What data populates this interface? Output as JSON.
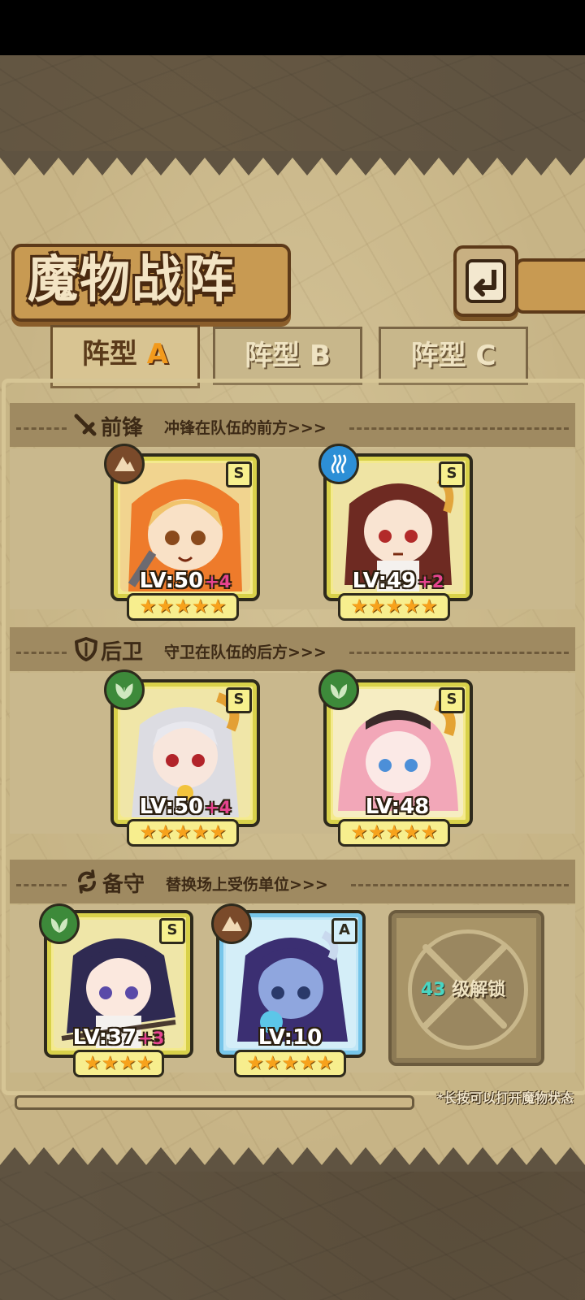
{
  "header": {
    "title": "魔物战阵"
  },
  "back_button": {
    "icon": "return-arrow-icon"
  },
  "tabs": [
    {
      "label": "阵型",
      "letter": "A",
      "active": true
    },
    {
      "label": "阵型",
      "letter": "B",
      "active": false
    },
    {
      "label": "阵型",
      "letter": "C",
      "active": false
    }
  ],
  "sections": {
    "front": {
      "icon": "sword-icon",
      "title": "前锋",
      "subtitle": "冲锋在队伍的前方>>>"
    },
    "rear": {
      "icon": "shield-icon",
      "title": "后卫",
      "subtitle": "守卫在队伍的后方>>>"
    },
    "reserve": {
      "icon": "swap-icon",
      "title": "备守",
      "subtitle": "替换场上受伤单位>>>"
    }
  },
  "monsters": {
    "front_1": {
      "rank": "S",
      "level": "LV:50",
      "bonus": "+4",
      "stars": "★★★★★",
      "element": "earth",
      "element_color": "#7a4a2a",
      "frame_color": "#f4ea8d"
    },
    "front_2": {
      "rank": "S",
      "level": "LV:49",
      "bonus": "+2",
      "stars": "★★★★★",
      "element": "water",
      "element_color": "#2d8fd6",
      "frame_color": "#f4ea8d"
    },
    "rear_1": {
      "rank": "S",
      "level": "LV:50",
      "bonus": "+4",
      "stars": "★★★★★",
      "element": "plant",
      "element_color": "#3d8a3a",
      "frame_color": "#f4ea8d"
    },
    "rear_2": {
      "rank": "S",
      "level": "LV:48",
      "bonus": "",
      "stars": "★★★★★",
      "element": "plant",
      "element_color": "#3d8a3a",
      "frame_color": "#f4ea8d"
    },
    "reserve_1": {
      "rank": "S",
      "level": "LV:37",
      "bonus": "+3",
      "stars": "★★★★",
      "element": "plant",
      "element_color": "#3d8a3a",
      "frame_color": "#f4ea8d"
    },
    "reserve_2": {
      "rank": "A",
      "level": "LV:10",
      "bonus": "",
      "stars": "★★★★★",
      "element": "earth",
      "element_color": "#7a4a2a",
      "frame_color": "#bfe6f6"
    }
  },
  "locked_slot": {
    "level": "43",
    "label": "级解锁"
  },
  "hint": "*长按可以打开魔物状态",
  "colors": {
    "accent_orange": "#f29a1c",
    "star_gold": "#f7a21c",
    "bonus_pink": "#e6448f",
    "unlock_teal": "#49d6c3"
  }
}
